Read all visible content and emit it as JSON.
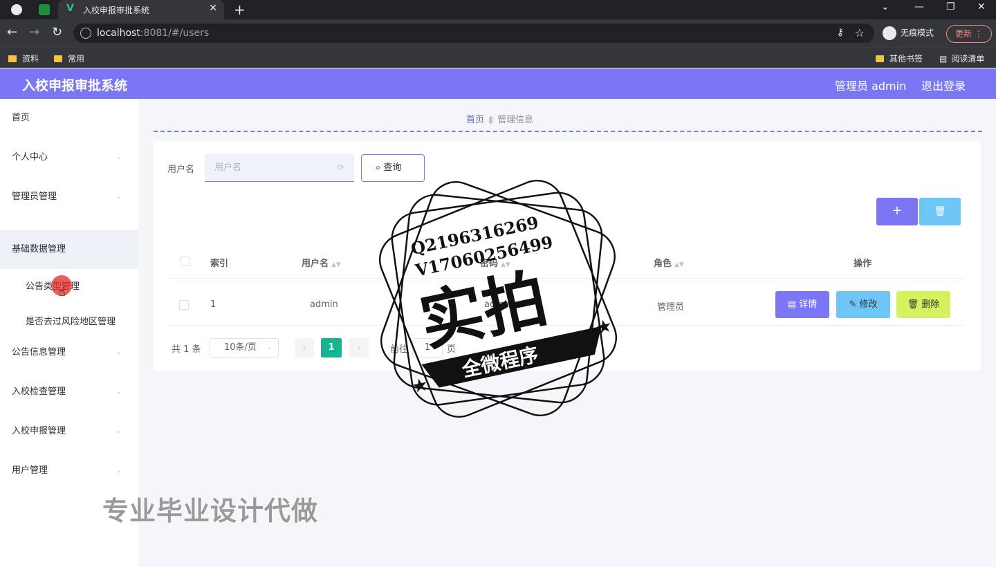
{
  "browser": {
    "tab_title": "入校申报审批系统",
    "url_host": "localhost",
    "url_path": ":8081/#/users",
    "incognito_label": "无痕模式",
    "update_label": "更新",
    "bookmarks": [
      "资料",
      "常用"
    ],
    "bookmarks_right": [
      "其他书签",
      "阅读清单"
    ]
  },
  "header": {
    "title": "入校申报审批系统",
    "user": "管理员 admin",
    "logout": "退出登录"
  },
  "sidebar": {
    "items": [
      {
        "label": "首页"
      },
      {
        "label": "个人中心"
      },
      {
        "label": "管理员管理"
      },
      {
        "label": "基础数据管理"
      },
      {
        "label": "公告信息管理"
      },
      {
        "label": "入校检查管理"
      },
      {
        "label": "入校申报管理"
      },
      {
        "label": "用户管理"
      }
    ],
    "sub_items": [
      {
        "label": "公告类型管理"
      },
      {
        "label": "是否去过风险地区管理"
      }
    ]
  },
  "breadcrumb": {
    "home": "首页",
    "current": "管理信息"
  },
  "search": {
    "label": "用户名",
    "placeholder": "用户名",
    "button": "查询"
  },
  "actions": {
    "add": "+",
    "delete": "🗑"
  },
  "table": {
    "columns": [
      "索引",
      "用户名",
      "密码",
      "角色",
      "操作"
    ],
    "rows": [
      {
        "index": "1",
        "username": "admin",
        "password": "admin",
        "role": "管理员"
      }
    ],
    "row_buttons": {
      "detail": "详情",
      "edit": "修改",
      "delete": "删除"
    }
  },
  "pagination": {
    "total": "共 1 条",
    "page_size": "10条/页",
    "current_page": "1",
    "goto_prefix": "前往",
    "goto_value": "1",
    "goto_suffix": "页"
  },
  "stamp": {
    "line1": "Q2196316269",
    "line2": "V17060256499",
    "big": "实拍",
    "ribbon": "全微程序"
  },
  "watermark": "专业毕业设计代做",
  "colors": {
    "primary": "#7b77f4",
    "info": "#6dc6f5",
    "warning": "#d4f25d",
    "pager": "#16b492"
  }
}
